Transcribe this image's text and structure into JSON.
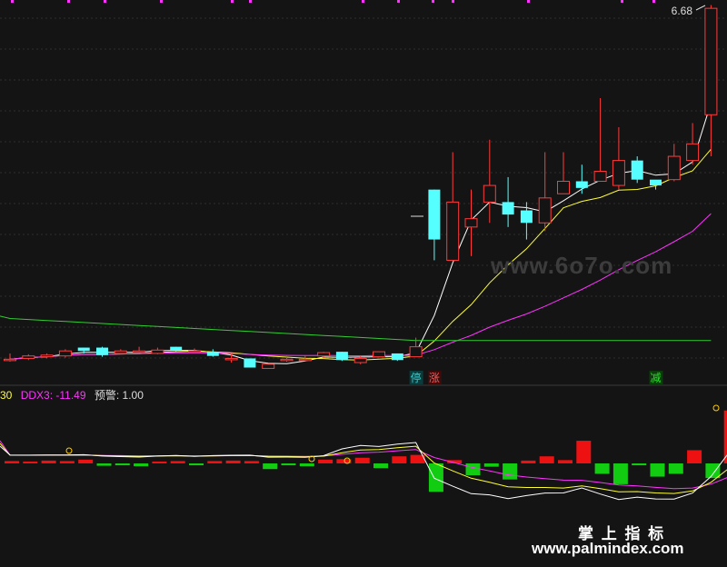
{
  "chart_data": [
    {
      "type": "candlestick",
      "price_label": "6.68",
      "ma_series": [
        {
          "color": "#ffffff"
        },
        {
          "color": "#ffff33"
        },
        {
          "color": "#ff33ff"
        },
        {
          "color": "#33cc33"
        }
      ],
      "candles": [
        {
          "o": 2.46,
          "c": 2.46,
          "h": 2.53,
          "l": 2.43
        },
        {
          "o": 2.47,
          "c": 2.5,
          "h": 2.52,
          "l": 2.45
        },
        {
          "o": 2.49,
          "c": 2.51,
          "h": 2.53,
          "l": 2.47
        },
        {
          "o": 2.5,
          "c": 2.56,
          "h": 2.58,
          "l": 2.48
        },
        {
          "o": 2.6,
          "c": 2.56,
          "h": 2.6,
          "l": 2.53
        },
        {
          "o": 2.6,
          "c": 2.51,
          "h": 2.61,
          "l": 2.49
        },
        {
          "o": 2.53,
          "c": 2.56,
          "h": 2.58,
          "l": 2.52
        },
        {
          "o": 2.56,
          "c": 2.56,
          "h": 2.61,
          "l": 2.54
        },
        {
          "o": 2.53,
          "c": 2.57,
          "h": 2.6,
          "l": 2.52
        },
        {
          "o": 2.61,
          "c": 2.57,
          "h": 2.61,
          "l": 2.55
        },
        {
          "o": 2.56,
          "c": 2.56,
          "h": 2.59,
          "l": 2.54
        },
        {
          "o": 2.55,
          "c": 2.5,
          "h": 2.58,
          "l": 2.49
        },
        {
          "o": 2.47,
          "c": 2.47,
          "h": 2.53,
          "l": 2.42
        },
        {
          "o": 2.47,
          "c": 2.36,
          "h": 2.47,
          "l": 2.36
        },
        {
          "o": 2.35,
          "c": 2.4,
          "h": 2.4,
          "l": 2.35
        },
        {
          "o": 2.46,
          "c": 2.46,
          "h": 2.5,
          "l": 2.43
        },
        {
          "o": 2.46,
          "c": 2.46,
          "h": 2.5,
          "l": 2.45
        },
        {
          "o": 2.5,
          "c": 2.54,
          "h": 2.55,
          "l": 2.47
        },
        {
          "o": 2.55,
          "c": 2.45,
          "h": 2.55,
          "l": 2.44
        },
        {
          "o": 2.42,
          "c": 2.47,
          "h": 2.5,
          "l": 2.4
        },
        {
          "o": 2.49,
          "c": 2.55,
          "h": 2.55,
          "l": 2.48
        },
        {
          "o": 2.53,
          "c": 2.45,
          "h": 2.53,
          "l": 2.44
        },
        {
          "o": 2.49,
          "c": 2.61,
          "h": 2.72,
          "l": 2.49
        },
        {
          "o": 4.5,
          "c": 3.9,
          "h": 4.5,
          "l": 3.65
        },
        {
          "o": 3.65,
          "c": 4.35,
          "h": 4.95,
          "l": 3.65
        },
        {
          "o": 4.05,
          "c": 4.15,
          "h": 4.5,
          "l": 3.7
        },
        {
          "o": 4.35,
          "c": 4.55,
          "h": 5.1,
          "l": 4.1
        },
        {
          "o": 4.35,
          "c": 4.2,
          "h": 4.65,
          "l": 4.05
        },
        {
          "o": 4.25,
          "c": 4.1,
          "h": 4.35,
          "l": 3.9
        },
        {
          "o": 4.1,
          "c": 4.4,
          "h": 4.95,
          "l": 4.0
        },
        {
          "o": 4.45,
          "c": 4.6,
          "h": 4.95,
          "l": 4.45
        },
        {
          "o": 4.6,
          "c": 4.52,
          "h": 4.8,
          "l": 4.45
        },
        {
          "o": 4.6,
          "c": 4.72,
          "h": 5.6,
          "l": 4.6
        },
        {
          "o": 4.55,
          "c": 4.85,
          "h": 5.25,
          "l": 4.5
        },
        {
          "o": 4.85,
          "c": 4.62,
          "h": 4.9,
          "l": 4.58
        },
        {
          "o": 4.62,
          "c": 4.55,
          "h": 4.6,
          "l": 4.5
        },
        {
          "o": 4.62,
          "c": 4.9,
          "h": 5.05,
          "l": 4.6
        },
        {
          "o": 4.85,
          "c": 5.05,
          "h": 5.3,
          "l": 4.8
        },
        {
          "o": 5.4,
          "c": 6.68,
          "h": 6.72,
          "l": 4.9
        }
      ],
      "signal_labels": [
        {
          "text": "停",
          "bar": 22,
          "color": "#33cccc",
          "bg": "#0c3b3b"
        },
        {
          "text": "涨",
          "bar": 23,
          "color": "#ff5555",
          "bg": "#3b0c0c"
        },
        {
          "text": "减",
          "bar": 35,
          "color": "#33dd33",
          "bg": "#0c3b0c"
        }
      ]
    },
    {
      "type": "bar-line",
      "header": [
        {
          "text": "30",
          "color": "#ffff33"
        },
        {
          "text": "DDX3: -11.49",
          "color": "#ff33ff"
        },
        {
          "text": "预警: 1.00",
          "color": "#dddddd"
        }
      ],
      "bars": [
        0.5,
        0.4,
        0.6,
        0.5,
        0.8,
        -0.5,
        -0.4,
        -0.6,
        0.4,
        0.5,
        -0.4,
        0.5,
        0.6,
        0.5,
        -1.2,
        -0.4,
        -0.6,
        0.8,
        0.9,
        1.2,
        -1.0,
        1.5,
        1.8,
        -6.0,
        0.7,
        -2.5,
        -0.7,
        -3.4,
        0.6,
        1.5,
        0.7,
        4.8,
        -2.2,
        -4.4,
        -0.4,
        -2.8,
        -2.2,
        2.8,
        -3.1,
        11.2
      ]
    }
  ],
  "watermark": "www.6o7o.com",
  "brand": {
    "line1": "掌 上 指 标",
    "line2": "www.palmindex.com"
  }
}
